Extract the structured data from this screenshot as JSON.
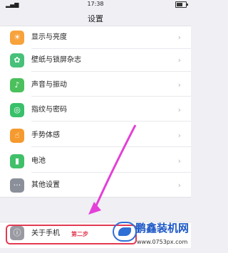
{
  "status_bar": {
    "time": "17:38"
  },
  "header": {
    "title": "设置"
  },
  "settings": {
    "items": [
      {
        "label": "显示与亮度",
        "icon": "display-brightness-icon",
        "color": "#f7a23b",
        "glyph": "☀"
      },
      {
        "label": "壁纸与锁屏杂志",
        "icon": "wallpaper-icon",
        "color": "#47c07a",
        "glyph": "✿"
      },
      {
        "label": "声音与振动",
        "icon": "sound-icon",
        "color": "#4bc05c",
        "glyph": "♪"
      },
      {
        "label": "指纹与密码",
        "icon": "fingerprint-icon",
        "color": "#39c06a",
        "glyph": "◎"
      },
      {
        "label": "手势体感",
        "icon": "gesture-icon",
        "color": "#f59a2e",
        "glyph": "☝"
      },
      {
        "label": "电池",
        "icon": "battery-icon",
        "color": "#41c06a",
        "glyph": "▮"
      },
      {
        "label": "其他设置",
        "icon": "more-icon",
        "color": "#8a8f99",
        "glyph": "···"
      }
    ],
    "chevron": "›"
  },
  "about": {
    "label": "关于手机",
    "icon": "info-icon",
    "glyph": "ⓘ",
    "step_annotation": "第二步"
  },
  "watermark": {
    "title": "鹏鑫装机网",
    "url": "www.0753px.com"
  },
  "colors": {
    "highlight": "#e23a52",
    "arrow": "#e43fd8",
    "watermark_blue": "#1e58c6"
  }
}
